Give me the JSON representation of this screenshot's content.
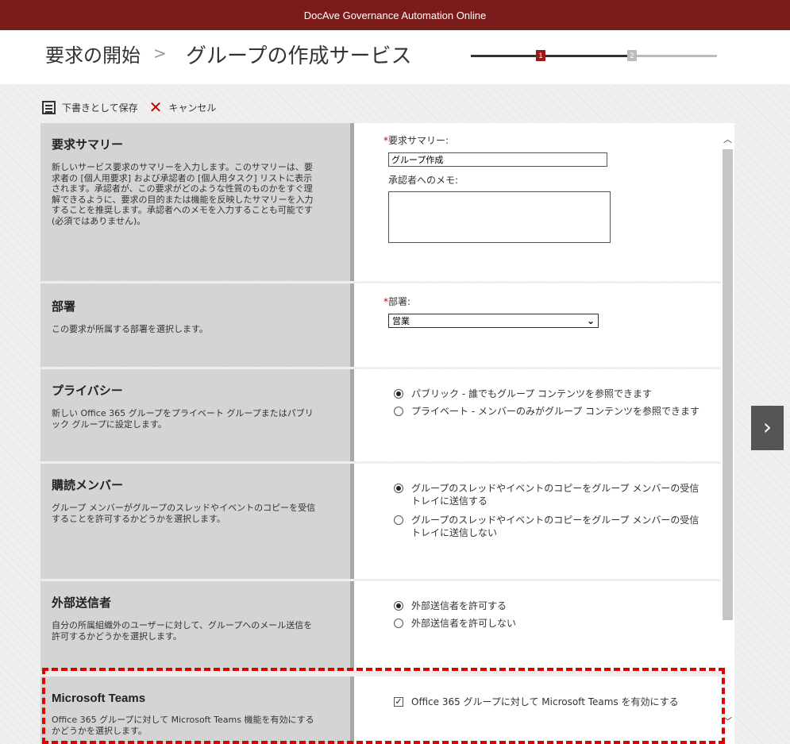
{
  "app_title": "DocAve Governance Automation Online",
  "breadcrumb": {
    "first": "要求の開始",
    "separator": ">",
    "current": "グループの作成サービス"
  },
  "steps": [
    {
      "label": "1",
      "active": true
    },
    {
      "label": "2",
      "active": false
    }
  ],
  "toolbar": {
    "save_label": "下書きとして保存",
    "cancel_label": "キャンセル"
  },
  "sections": {
    "summary": {
      "title": "要求サマリー",
      "desc": "新しいサービス要求のサマリーを入力します。このサマリーは、要求者の [個人用要求] および承認者の [個人用タスク] リストに表示されます。承認者が、この要求がどのような性質のものかをすぐ理解できるように、要求の目的または機能を反映したサマリーを入力することを推奨します。承認者へのメモを入力することも可能です (必須ではありません)。",
      "field_label": "要求サマリー:",
      "field_value": "グループ作成",
      "memo_label": "承認者へのメモ:",
      "memo_value": ""
    },
    "department": {
      "title": "部署",
      "desc": "この要求が所属する部署を選択します。",
      "field_label": "部署:",
      "selected": "営業"
    },
    "privacy": {
      "title": "プライバシー",
      "desc": "新しい Office 365 グループをプライベート グループまたはパブリック グループに設定します。",
      "options": [
        {
          "label": "パブリック - 誰でもグループ コンテンツを参照できます",
          "checked": true
        },
        {
          "label": "プライベート - メンバーのみがグループ コンテンツを参照できます",
          "checked": false
        }
      ]
    },
    "subscribe": {
      "title": "購読メンバー",
      "desc": "グループ メンバーがグループのスレッドやイベントのコピーを受信することを許可するかどうかを選択します。",
      "options": [
        {
          "label": "グループのスレッドやイベントのコピーをグループ メンバーの受信トレイに送信する",
          "checked": true
        },
        {
          "label": "グループのスレッドやイベントのコピーをグループ メンバーの受信トレイに送信しない",
          "checked": false
        }
      ]
    },
    "external": {
      "title": "外部送信者",
      "desc": "自分の所属組織外のユーザーに対して、グループへのメール送信を許可するかどうかを選択します。",
      "options": [
        {
          "label": "外部送信者を許可する",
          "checked": true
        },
        {
          "label": "外部送信者を許可しない",
          "checked": false
        }
      ]
    },
    "teams": {
      "title": "Microsoft Teams",
      "desc": "Office 365 グループに対して Microsoft Teams 機能を有効にするかどうかを選択します。",
      "checkbox_label": "Office 365 グループに対して Microsoft Teams を有効にする",
      "checked": true
    }
  },
  "icons": {
    "save": "save-draft-icon",
    "cancel": "x-icon",
    "next": "chevron-right-icon"
  },
  "next_glyph": "›",
  "colors": {
    "topbar": "#7a1c1c",
    "step_active": "#9b1b1b",
    "highlight": "#e00000"
  }
}
